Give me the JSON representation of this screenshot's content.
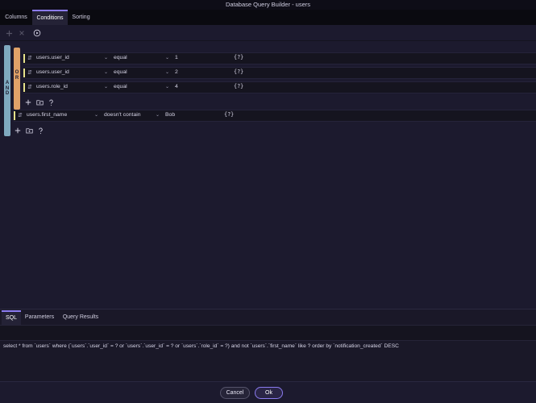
{
  "window": {
    "title": "Database Query Builder - users"
  },
  "tabs": [
    {
      "label": "Columns",
      "active": false
    },
    {
      "label": "Conditions",
      "active": true
    },
    {
      "label": "Sorting",
      "active": false
    }
  ],
  "toolbar": {
    "icons": [
      "plus-icon",
      "close-icon",
      "play-icon"
    ]
  },
  "groups": {
    "and_label": "A N D",
    "or_label": "O R"
  },
  "conditions": [
    {
      "field": "users.user_id",
      "operator": "equal",
      "value": "1",
      "param": "{?}"
    },
    {
      "field": "users.user_id",
      "operator": "equal",
      "value": "2",
      "param": "{?}"
    },
    {
      "field": "users.role_id",
      "operator": "equal",
      "value": "4",
      "param": "{?}"
    },
    {
      "field": "users.first_name",
      "operator": "doesn't contain",
      "value": "Bob",
      "param": "{?}"
    }
  ],
  "bottom_tabs": [
    {
      "label": "SQL",
      "active": true
    },
    {
      "label": "Parameters",
      "active": false
    },
    {
      "label": "Query Results",
      "active": false
    }
  ],
  "sql": {
    "text": "select * from `users` where (`users`.`user_id` = ? or `users`.`user_id` = ? or `users`.`role_id` = ?) and not `users`.`first_name` like ? order by `notification_created` DESC"
  },
  "footer": {
    "cancel_label": "Cancel",
    "ok_label": "Ok"
  },
  "colors": {
    "accent": "#8b7bf0",
    "and_group": "#7fa9bf",
    "or_group": "#e0a268",
    "row_marker": "#e6e28a"
  }
}
